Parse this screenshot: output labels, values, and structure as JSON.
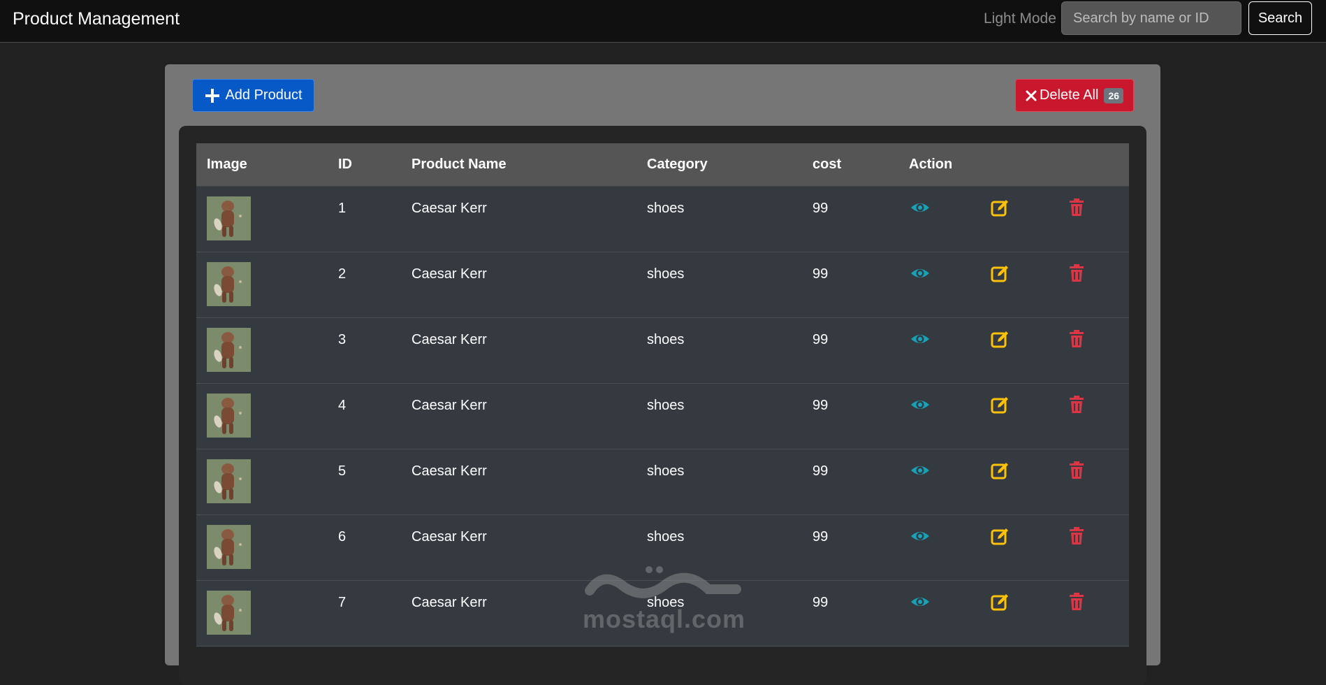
{
  "navbar": {
    "title": "Product Management",
    "mode_label": "Light Mode",
    "search_placeholder": "Search by name or ID",
    "search_button": "Search"
  },
  "toolbar": {
    "add_label": "Add Product",
    "delete_label": "Delete All",
    "delete_count": "26"
  },
  "table": {
    "headers": [
      "Image",
      "ID",
      "Product Name",
      "Category",
      "cost",
      "Action"
    ],
    "rows": [
      {
        "id": "1",
        "name": "Caesar Kerr",
        "category": "shoes",
        "cost": "99"
      },
      {
        "id": "2",
        "name": "Caesar Kerr",
        "category": "shoes",
        "cost": "99"
      },
      {
        "id": "3",
        "name": "Caesar Kerr",
        "category": "shoes",
        "cost": "99"
      },
      {
        "id": "4",
        "name": "Caesar Kerr",
        "category": "shoes",
        "cost": "99"
      },
      {
        "id": "5",
        "name": "Caesar Kerr",
        "category": "shoes",
        "cost": "99"
      },
      {
        "id": "6",
        "name": "Caesar Kerr",
        "category": "shoes",
        "cost": "99"
      },
      {
        "id": "7",
        "name": "Caesar Kerr",
        "category": "shoes",
        "cost": "99"
      }
    ]
  },
  "icons": {
    "add": "plus-icon",
    "delete": "x-icon",
    "view": "eye-icon",
    "edit": "edit-icon",
    "remove": "trash-icon"
  },
  "colors": {
    "primary": "#0759c7",
    "danger": "#c9182e",
    "view": "#17a2b8",
    "edit": "#ffc107",
    "remove": "#dc3545"
  },
  "watermark": {
    "text": "mostaql.com"
  }
}
